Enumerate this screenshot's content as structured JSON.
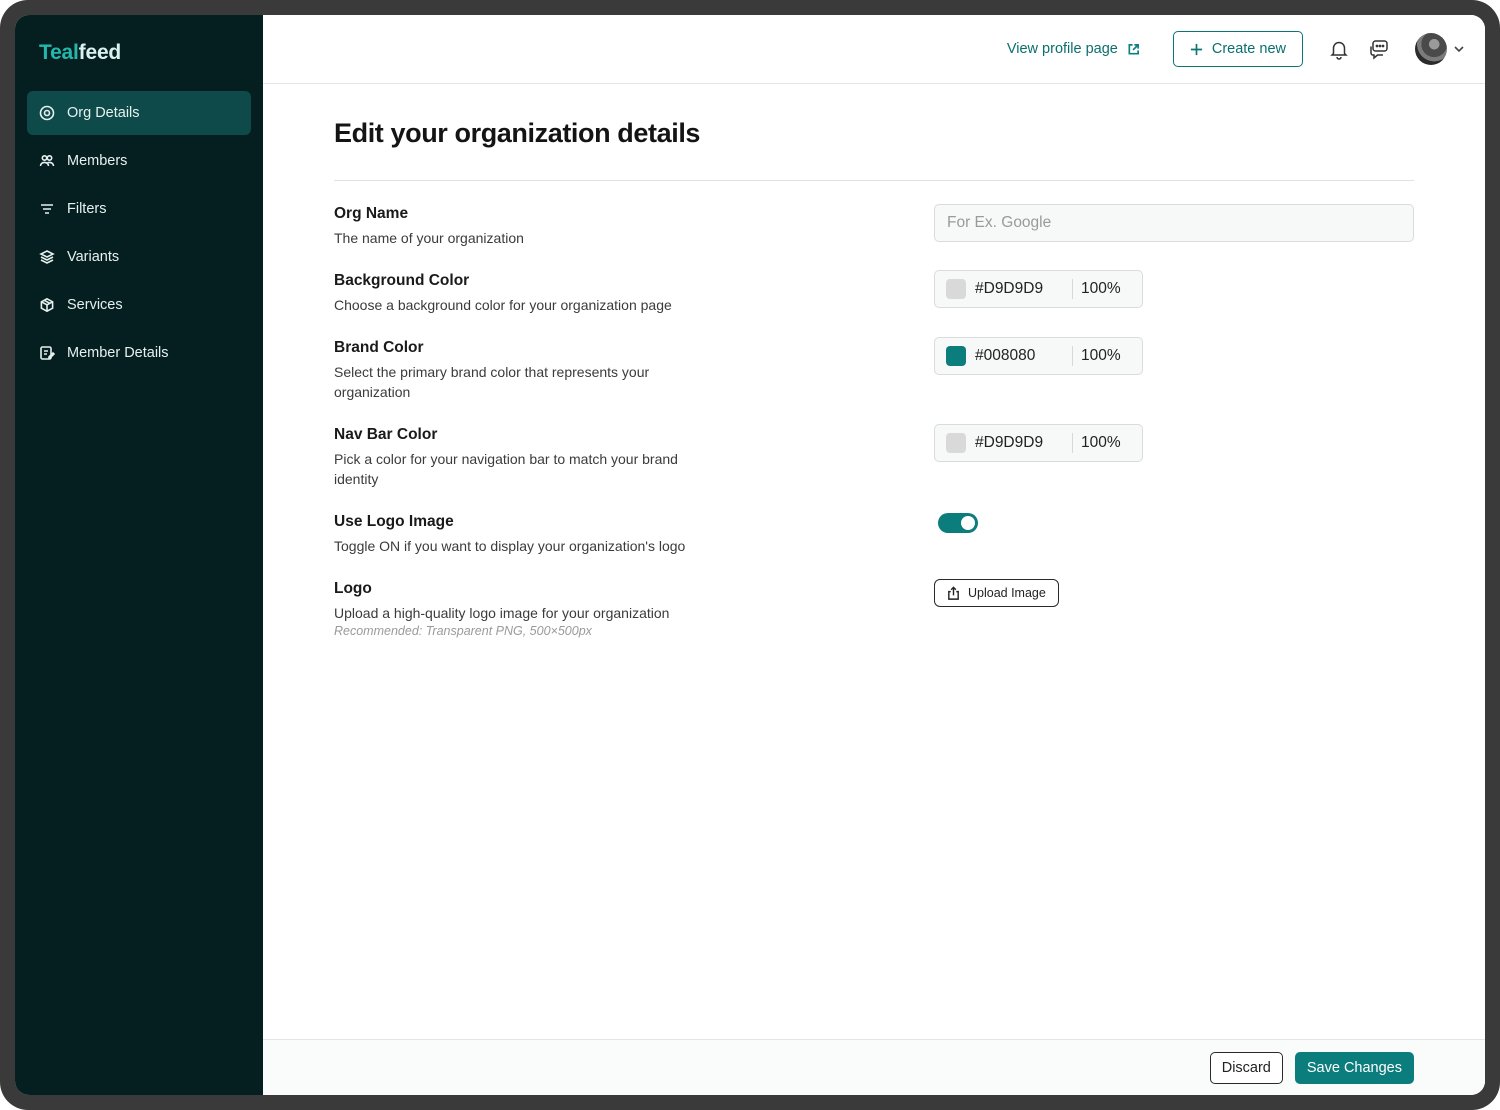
{
  "brand": {
    "part1": "Teal",
    "part2": "feed"
  },
  "sidebar": {
    "items": [
      {
        "label": "Org Details",
        "icon": "target-icon",
        "active": true
      },
      {
        "label": "Members",
        "icon": "users-icon",
        "active": false
      },
      {
        "label": "Filters",
        "icon": "filter-icon",
        "active": false
      },
      {
        "label": "Variants",
        "icon": "layers-icon",
        "active": false
      },
      {
        "label": "Services",
        "icon": "box-icon",
        "active": false
      },
      {
        "label": "Member Details",
        "icon": "edit-doc-icon",
        "active": false
      }
    ]
  },
  "topbar": {
    "profile_link": "View profile page",
    "create_new": "Create new"
  },
  "page": {
    "title": "Edit your organization details"
  },
  "fields": {
    "org_name": {
      "label": "Org Name",
      "desc": "The name of your organization",
      "placeholder": "For Ex. Google",
      "value": ""
    },
    "background_color": {
      "label": "Background Color",
      "desc": "Choose a background color for your organization page",
      "hex": "#D9D9D9",
      "opacity": "100%",
      "swatch": "#D9D9D9"
    },
    "brand_color": {
      "label": "Brand Color",
      "desc": "Select the primary brand color that represents your organization",
      "hex": "#008080",
      "opacity": "100%",
      "swatch": "#008080"
    },
    "nav_bar_color": {
      "label": "Nav Bar Color",
      "desc": "Pick a color for your navigation bar to match your brand identity",
      "hex": "#D9D9D9",
      "opacity": "100%",
      "swatch": "#D9D9D9"
    },
    "use_logo": {
      "label": "Use Logo Image",
      "desc": "Toggle ON if you want to display your organization's logo",
      "enabled": true
    },
    "logo": {
      "label": "Logo",
      "desc": "Upload a high-quality logo image for your organization",
      "hint": "Recommended: Transparent PNG, 500×500px",
      "upload_label": "Upload Image"
    }
  },
  "footer": {
    "discard": "Discard",
    "save": "Save Changes"
  },
  "colors": {
    "sidebar_bg": "#051f20",
    "active_item": "#0e4a49",
    "accent": "#0b7d7c"
  }
}
